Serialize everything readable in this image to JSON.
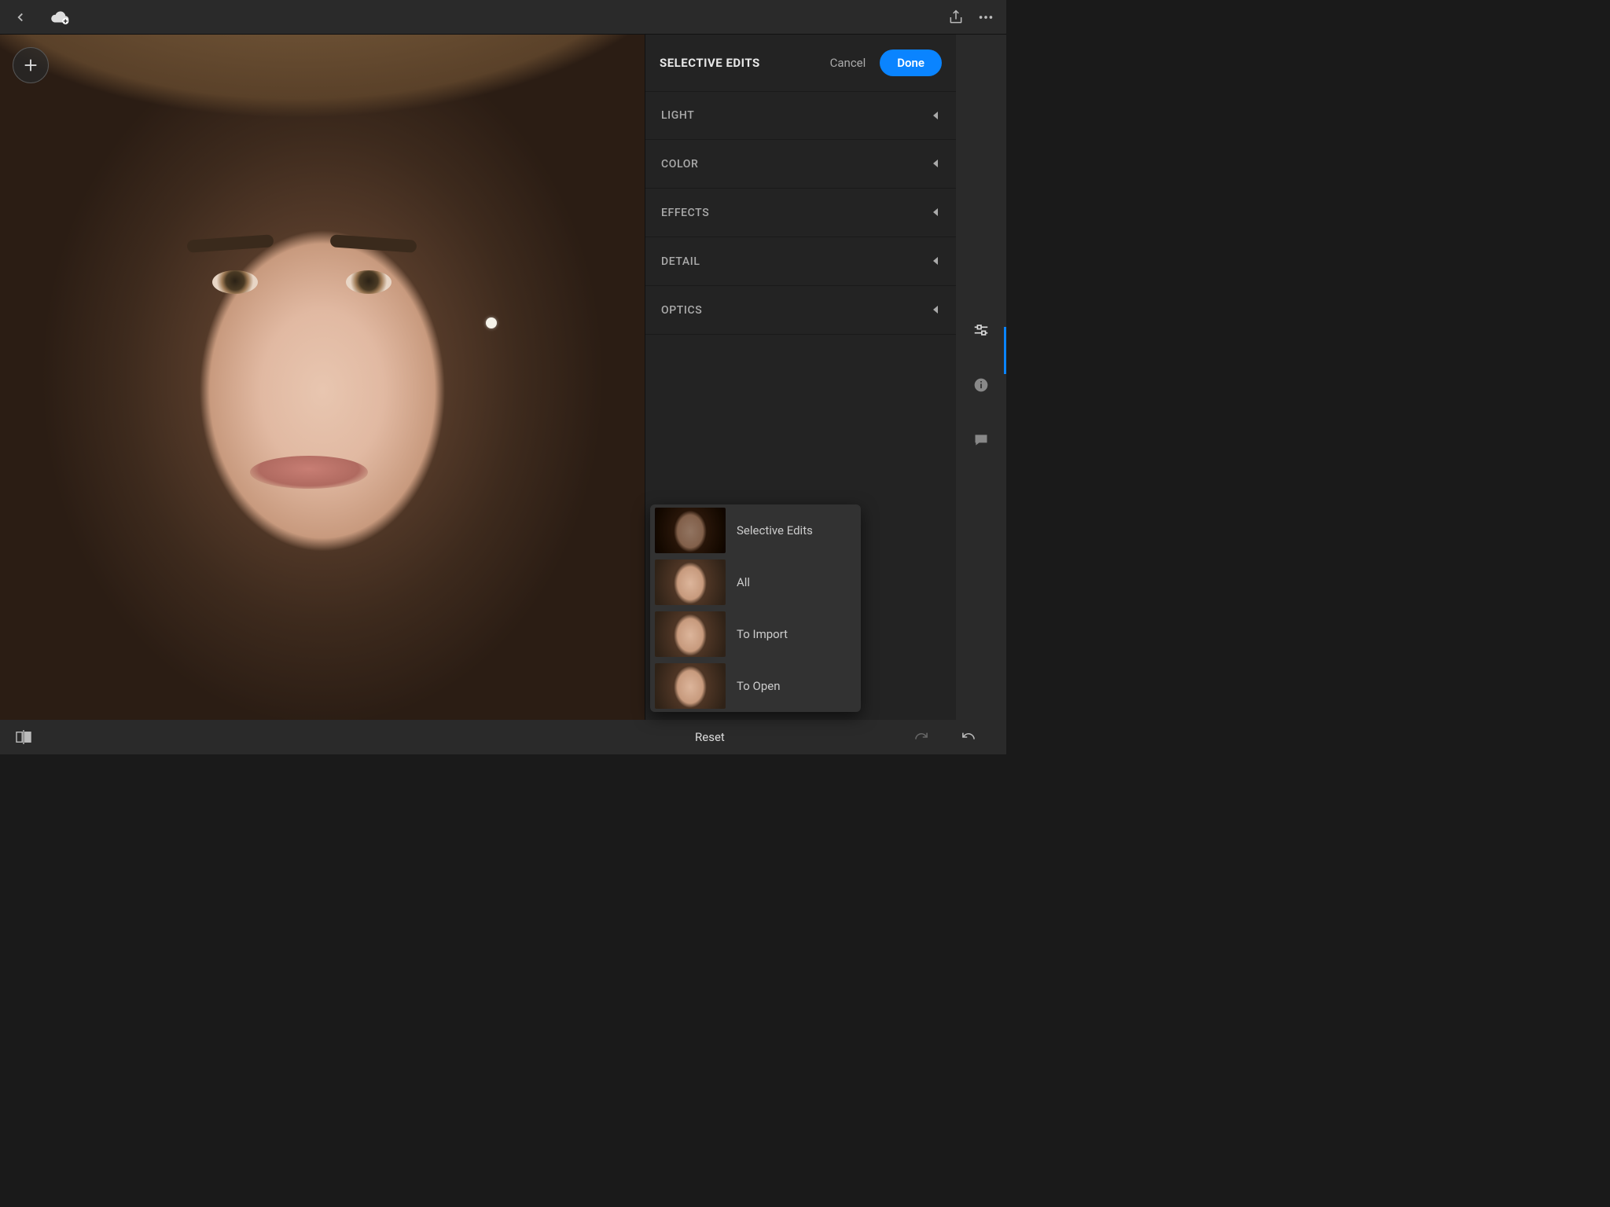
{
  "header": {
    "title": "SELECTIVE EDITS",
    "cancel": "Cancel",
    "done": "Done"
  },
  "sections": [
    {
      "label": "LIGHT"
    },
    {
      "label": "COLOR"
    },
    {
      "label": "EFFECTS"
    },
    {
      "label": "DETAIL"
    },
    {
      "label": "OPTICS"
    }
  ],
  "reset_menu": {
    "items": [
      {
        "label": "Selective Edits"
      },
      {
        "label": "All"
      },
      {
        "label": "To Import"
      },
      {
        "label": "To Open"
      }
    ]
  },
  "bottom": {
    "reset": "Reset"
  },
  "rail": {
    "items": [
      "adjust",
      "info",
      "comment"
    ]
  }
}
